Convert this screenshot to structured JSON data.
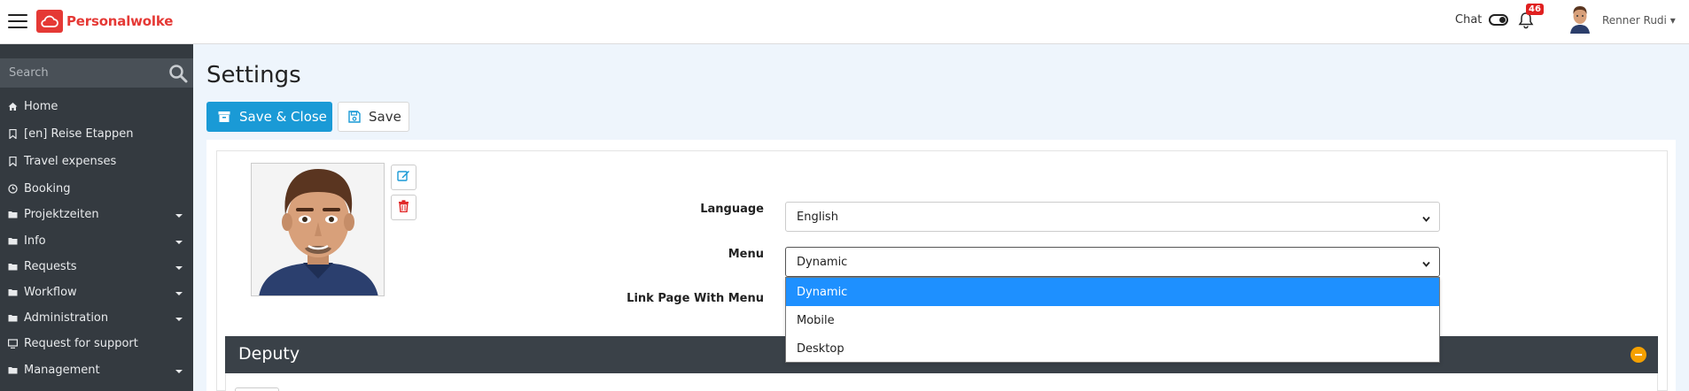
{
  "brand": {
    "name": "Personalwolke",
    "color": "#e53935"
  },
  "topbar": {
    "chat_label": "Chat",
    "notification_count": "46",
    "user_name": "Renner Rudi"
  },
  "sidebar": {
    "search_placeholder": "Search",
    "items": [
      {
        "label": "Home",
        "icon": "home-icon",
        "has_submenu": false
      },
      {
        "label": "[en] Reise Etappen",
        "icon": "bookmark-icon",
        "has_submenu": false
      },
      {
        "label": "Travel expenses",
        "icon": "bookmark-icon",
        "has_submenu": false
      },
      {
        "label": "Booking",
        "icon": "clock-icon",
        "has_submenu": false
      },
      {
        "label": "Projektzeiten",
        "icon": "folder-icon",
        "has_submenu": true
      },
      {
        "label": "Info",
        "icon": "folder-icon",
        "has_submenu": true
      },
      {
        "label": "Requests",
        "icon": "folder-icon",
        "has_submenu": true
      },
      {
        "label": "Workflow",
        "icon": "folder-icon",
        "has_submenu": true
      },
      {
        "label": "Administration",
        "icon": "folder-icon",
        "has_submenu": true
      },
      {
        "label": "Request for support",
        "icon": "monitor-icon",
        "has_submenu": false
      },
      {
        "label": "Management",
        "icon": "folder-icon",
        "has_submenu": true
      }
    ]
  },
  "main": {
    "title": "Settings",
    "save_close_label": "Save & Close",
    "save_label": "Save",
    "form": {
      "language_label": "Language",
      "language_value": "English",
      "menu_label": "Menu",
      "menu_value": "Dynamic",
      "link_page_label": "Link Page With Menu",
      "menu_options": [
        "Dynamic",
        "Mobile",
        "Desktop"
      ],
      "menu_selected_index": 0
    },
    "deputy_title": "Deputy"
  },
  "colors": {
    "primary": "#1a9ad6",
    "sidebar_bg": "#343a40",
    "section_bg": "#3a4148",
    "collapse": "#f5a000",
    "selected_option": "#1e90ff",
    "delete": "#e02020"
  }
}
